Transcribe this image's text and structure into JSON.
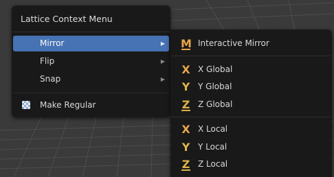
{
  "colors": {
    "menu_bg": "#191919",
    "highlight": "#4772b3",
    "viewport_bg": "#3a3a3a",
    "grid_line": "#505050",
    "axis_icon": "#e8a64a"
  },
  "main_menu": {
    "title": "Lattice Context Menu",
    "items": [
      {
        "label": "Mirror",
        "icon": "none",
        "has_submenu": true,
        "active": true
      },
      {
        "label": "Flip",
        "icon": "none",
        "has_submenu": true,
        "active": false
      },
      {
        "label": "Snap",
        "icon": "none",
        "has_submenu": true,
        "active": false
      },
      {
        "label": "Make Regular",
        "icon": "checker-icon",
        "has_submenu": false,
        "active": false
      }
    ]
  },
  "submenu": {
    "items": [
      {
        "label": "Interactive Mirror",
        "icon": "mirror-icon",
        "glyph": "M"
      },
      {
        "label": "X Global",
        "icon": "x-axis-icon",
        "glyph": "X"
      },
      {
        "label": "Y Global",
        "icon": "y-axis-icon",
        "glyph": "Y"
      },
      {
        "label": "Z Global",
        "icon": "z-axis-icon",
        "glyph": "Z"
      },
      {
        "label": "X Local",
        "icon": "x-axis-icon",
        "glyph": "X"
      },
      {
        "label": "Y Local",
        "icon": "y-axis-icon",
        "glyph": "Y"
      },
      {
        "label": "Z Local",
        "icon": "z-axis-icon",
        "glyph": "Z"
      }
    ]
  }
}
